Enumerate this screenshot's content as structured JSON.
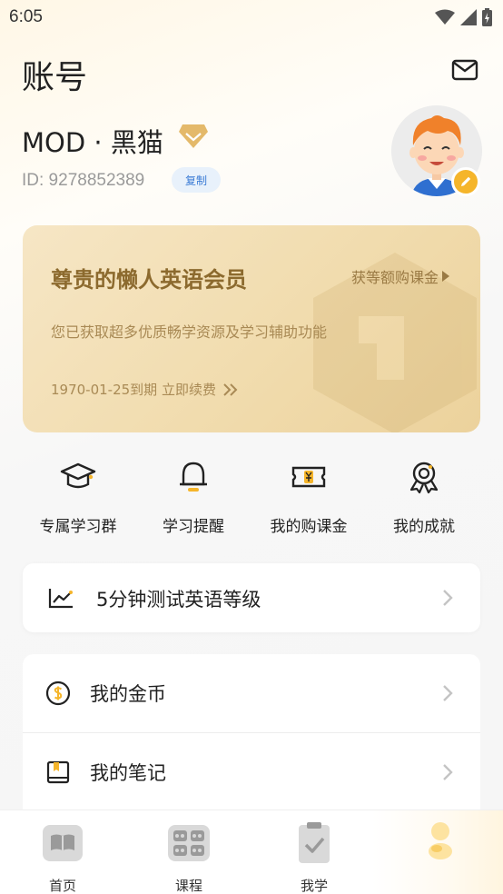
{
  "status_bar": {
    "time": "6:05"
  },
  "header": {
    "title": "账号"
  },
  "profile": {
    "username": "MOD · 黑猫",
    "user_id": "ID: 9278852389",
    "copy_label": "复制"
  },
  "vip_card": {
    "title": "尊贵的懒人英语会员",
    "link_label": "获等额购课金",
    "description": "您已获取超多优质畅学资源及学习辅助功能",
    "expire_text": "1970-01-25到期 立即续费"
  },
  "quick_actions": [
    {
      "label": "专属学习群",
      "icon": "graduation-cap-icon"
    },
    {
      "label": "学习提醒",
      "icon": "bell-icon"
    },
    {
      "label": "我的购课金",
      "icon": "coupon-icon"
    },
    {
      "label": "我的成就",
      "icon": "medal-icon"
    }
  ],
  "level_test": {
    "label": "5分钟测试英语等级",
    "icon": "chart-icon"
  },
  "menu": [
    {
      "label": "我的金币",
      "icon": "coin-icon"
    },
    {
      "label": "我的笔记",
      "icon": "notebook-icon"
    }
  ],
  "tab_bar": [
    {
      "label": "首页",
      "icon": "book-icon"
    },
    {
      "label": "课程",
      "icon": "grid-icon"
    },
    {
      "label": "我学",
      "icon": "clipboard-icon"
    },
    {
      "label": "",
      "icon": "profile-icon"
    }
  ],
  "colors": {
    "accent_gold": "#f5b52b",
    "vip_text": "#8c6a2e",
    "copy_blue": "#3a7bd5"
  }
}
